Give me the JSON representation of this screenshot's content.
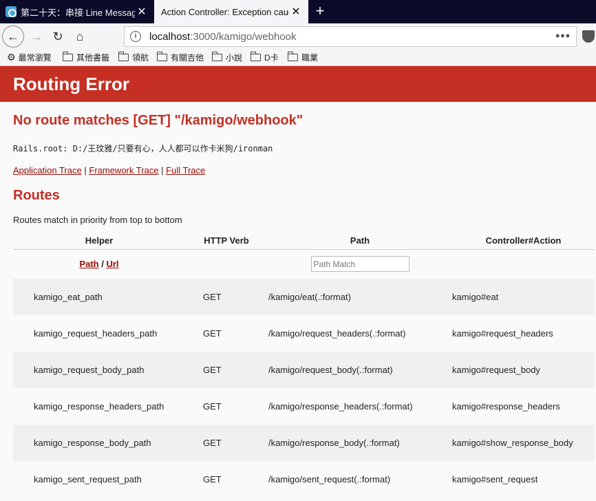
{
  "browser": {
    "tabs": [
      {
        "title": "第二十天：串接 Line Messaging",
        "active": false
      },
      {
        "title": "Action Controller: Exception caug",
        "active": true
      }
    ],
    "url_host": "localhost",
    "url_rest": ":3000/kamigo/webhook",
    "bookmarks": [
      "最常瀏覽",
      "其他書籤",
      "領航",
      "有關吉他",
      "小說",
      "D卡",
      "職業"
    ]
  },
  "page": {
    "header": "Routing Error",
    "error": "No route matches [GET] \"/kamigo/webhook\"",
    "rails_root": "Rails.root: D:/王玟雅/只要有心，人人都可以作卡米狗/ironman",
    "traces": {
      "application": "Application Trace",
      "framework": "Framework Trace",
      "full": "Full Trace",
      "sep": "|"
    },
    "routes_title": "Routes",
    "routes_desc": "Routes match in priority from top to bottom",
    "columns": {
      "helper": "Helper",
      "verb": "HTTP Verb",
      "path": "Path",
      "action": "Controller#Action"
    },
    "helper_links": {
      "path": "Path",
      "sep": " / ",
      "url": "Url"
    },
    "path_placeholder": "Path Match",
    "routes": [
      {
        "helper": "kamigo_eat_path",
        "verb": "GET",
        "path": "/kamigo/eat(.:format)",
        "action": "kamigo#eat"
      },
      {
        "helper": "kamigo_request_headers_path",
        "verb": "GET",
        "path": "/kamigo/request_headers(.:format)",
        "action": "kamigo#request_headers"
      },
      {
        "helper": "kamigo_request_body_path",
        "verb": "GET",
        "path": "/kamigo/request_body(.:format)",
        "action": "kamigo#request_body"
      },
      {
        "helper": "kamigo_response_headers_path",
        "verb": "GET",
        "path": "/kamigo/response_headers(.:format)",
        "action": "kamigo#response_headers"
      },
      {
        "helper": "kamigo_response_body_path",
        "verb": "GET",
        "path": "/kamigo/response_body(.:format)",
        "action": "kamigo#show_response_body"
      },
      {
        "helper": "kamigo_sent_request_path",
        "verb": "GET",
        "path": "/kamigo/sent_request(.:format)",
        "action": "kamigo#sent_request"
      }
    ]
  }
}
